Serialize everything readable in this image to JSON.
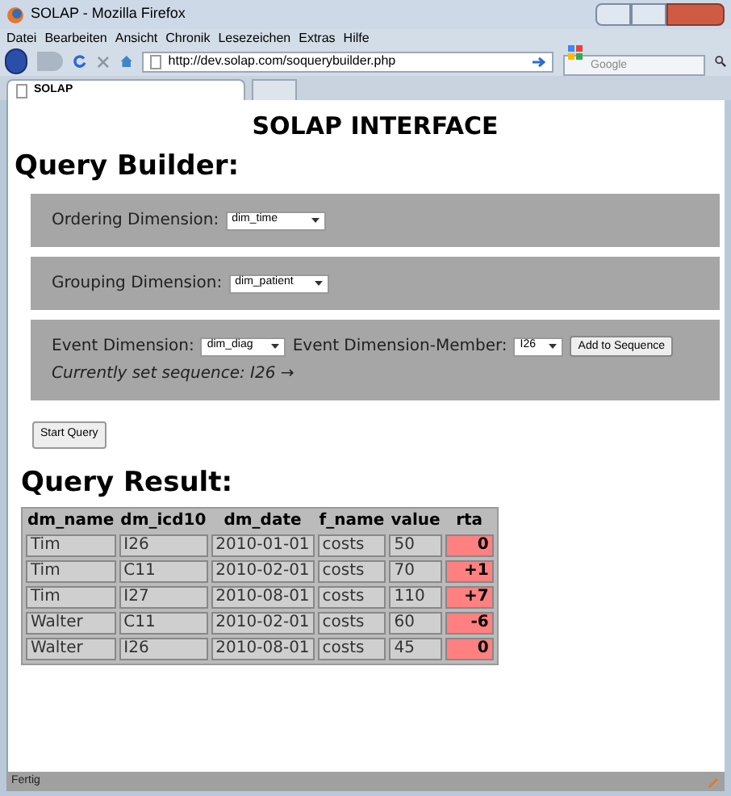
{
  "window": {
    "title": "SOLAP - Mozilla Firefox"
  },
  "menu": [
    "Datei",
    "Bearbeiten",
    "Ansicht",
    "Chronik",
    "Lesezeichen",
    "Extras",
    "Hilfe"
  ],
  "address_bar": {
    "value": "http://dev.solap.com/soquerybuilder.php"
  },
  "search": {
    "placeholder": "Google"
  },
  "tabs": [
    {
      "label": "SOLAP",
      "selected": true
    }
  ],
  "page": {
    "title": "SOLAP INTERFACE",
    "builder_heading": "Query Builder:",
    "panels": [
      {
        "kind": "single",
        "label": "Ordering Dimension:",
        "select": "dim_time"
      },
      {
        "kind": "single",
        "label": "Grouping Dimension:",
        "select": "dim_patient"
      },
      {
        "kind": "event",
        "label": "Event Dimension:",
        "select": "dim_diag",
        "member_label": "Event Dimension-Member:",
        "member_select": "I26",
        "button": "Add to Sequence",
        "sequence": "Currently set sequence: I26 →"
      }
    ],
    "start_button": "Start Query",
    "result_heading": "Query Result:",
    "table": {
      "columns": [
        "dm_name",
        "dm_icd10",
        "dm_date",
        "f_name",
        "value",
        "rta"
      ],
      "rows": [
        [
          "Tim",
          "I26",
          "2010-01-01",
          "costs",
          "50",
          "0"
        ],
        [
          "Tim",
          "C11",
          "2010-02-01",
          "costs",
          "70",
          "+1"
        ],
        [
          "Tim",
          "I27",
          "2010-08-01",
          "costs",
          "110",
          "+7"
        ],
        [
          "Walter",
          "C11",
          "2010-02-01",
          "costs",
          "60",
          "-6"
        ],
        [
          "Walter",
          "I26",
          "2010-08-01",
          "costs",
          "45",
          "0"
        ]
      ]
    }
  },
  "status_bar": {
    "text": "Fertig"
  }
}
